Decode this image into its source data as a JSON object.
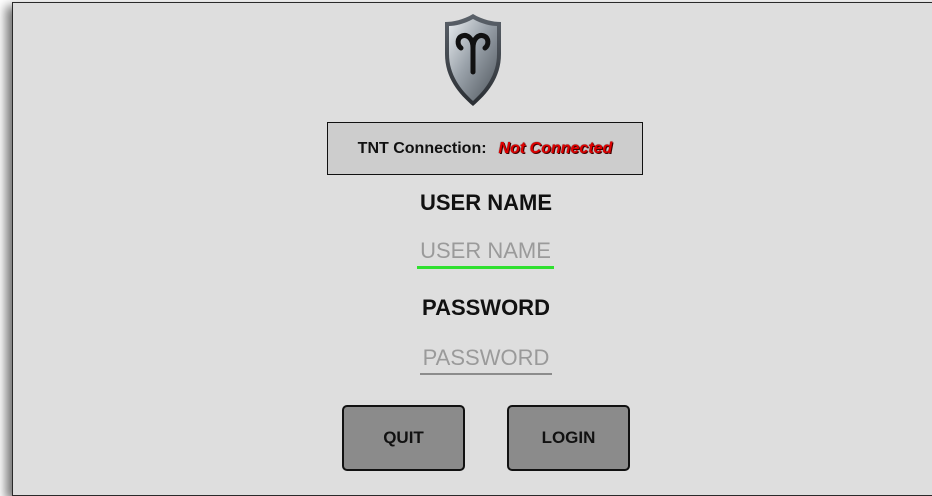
{
  "logo": {
    "icon": "aries-shield-icon",
    "colors": {
      "shield": "#8a929a",
      "rim": "#3a3f44",
      "symbol": "#111111"
    }
  },
  "status": {
    "label": "TNT Connection:",
    "value": "Not Connected",
    "value_color": "#e00000"
  },
  "username": {
    "label": "USER NAME",
    "placeholder": "USER NAME",
    "value": "",
    "underline_color": "#2fe02f"
  },
  "password": {
    "label": "PASSWORD",
    "placeholder": "PASSWORD",
    "value": ""
  },
  "buttons": {
    "quit": "QUIT",
    "login": "LOGIN"
  }
}
